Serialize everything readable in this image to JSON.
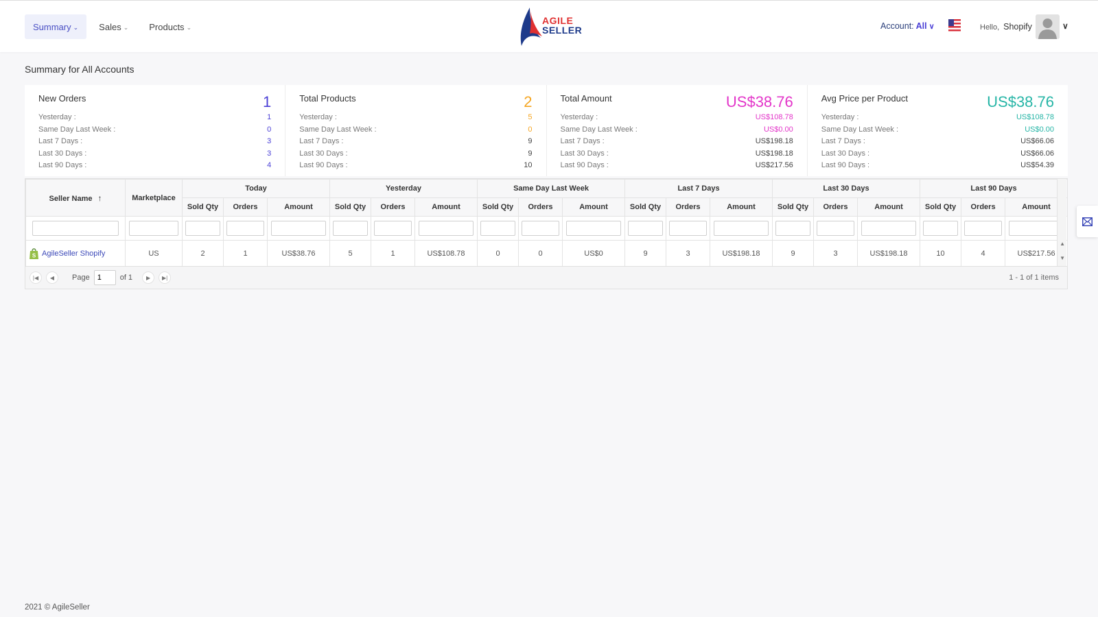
{
  "nav": {
    "items": [
      {
        "label": "Summary"
      },
      {
        "label": "Sales"
      },
      {
        "label": "Products"
      }
    ]
  },
  "logo": {
    "line1": "AGILE",
    "line2": "SELLER"
  },
  "account": {
    "label": "Account:",
    "value": "All"
  },
  "user": {
    "hello": "Hello,",
    "name": "Shopify"
  },
  "page_title": "Summary for All Accounts",
  "cards": [
    {
      "title": "New Orders",
      "value": "1",
      "color": "#4a3fd6",
      "rows": [
        {
          "label": "Yesterday :",
          "value": "1"
        },
        {
          "label": "Same Day Last Week :",
          "value": "0"
        },
        {
          "label": "Last 7 Days :",
          "value": "3"
        },
        {
          "label": "Last 30 Days :",
          "value": "3"
        },
        {
          "label": "Last 90 Days :",
          "value": "4"
        }
      ]
    },
    {
      "title": "Total Products",
      "value": "2",
      "color": "#f5a623",
      "rows": [
        {
          "label": "Yesterday :",
          "value": "5"
        },
        {
          "label": "Same Day Last Week :",
          "value": "0"
        },
        {
          "label": "Last 7 Days :",
          "value": "9"
        },
        {
          "label": "Last 30 Days :",
          "value": "9"
        },
        {
          "label": "Last 90 Days :",
          "value": "10"
        }
      ]
    },
    {
      "title": "Total Amount",
      "value": "US$38.76",
      "color": "#e335c9",
      "rows": [
        {
          "label": "Yesterday :",
          "value": "US$108.78"
        },
        {
          "label": "Same Day Last Week :",
          "value": "US$0.00"
        },
        {
          "label": "Last 7 Days :",
          "value": "US$198.18"
        },
        {
          "label": "Last 30 Days :",
          "value": "US$198.18"
        },
        {
          "label": "Last 90 Days :",
          "value": "US$217.56"
        }
      ]
    },
    {
      "title": "Avg Price per Product",
      "value": "US$38.76",
      "color": "#26b5a6",
      "rows": [
        {
          "label": "Yesterday :",
          "value": "US$108.78"
        },
        {
          "label": "Same Day Last Week :",
          "value": "US$0.00"
        },
        {
          "label": "Last 7 Days :",
          "value": "US$66.06"
        },
        {
          "label": "Last 30 Days :",
          "value": "US$66.06"
        },
        {
          "label": "Last 90 Days :",
          "value": "US$54.39"
        }
      ]
    }
  ],
  "table": {
    "seller_header": "Seller Name",
    "marketplace_header": "Marketplace",
    "groups": [
      "Today",
      "Yesterday",
      "Same Day Last Week",
      "Last 7 Days",
      "Last 30 Days",
      "Last 90 Days"
    ],
    "sub_headers": [
      "Sold Qty",
      "Orders",
      "Amount"
    ],
    "rows": [
      {
        "seller": "AgileSeller Shopify",
        "marketplace": "US",
        "values": [
          "2",
          "1",
          "US$38.76",
          "5",
          "1",
          "US$108.78",
          "0",
          "0",
          "US$0",
          "9",
          "3",
          "US$198.18",
          "9",
          "3",
          "US$198.18",
          "10",
          "4",
          "US$217.56"
        ]
      }
    ]
  },
  "pager": {
    "page_label": "Page",
    "page_value": "1",
    "of_label": "of 1",
    "items_info": "1 - 1 of 1 items"
  },
  "footer": "2021 © AgileSeller"
}
